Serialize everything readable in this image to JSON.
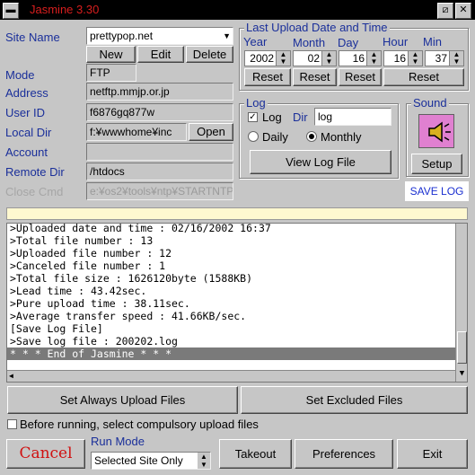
{
  "window": {
    "title": "Jasmine 3.30"
  },
  "site": {
    "site_name_label": "Site Name",
    "site_name_value": "prettypop.net",
    "new_label": "New",
    "edit_label": "Edit",
    "delete_label": "Delete",
    "mode_label": "Mode",
    "mode_value": "FTP",
    "address_label": "Address",
    "address_value": "netftp.mmjp.or.jp",
    "userid_label": "User ID",
    "userid_value": "f6876gq877w",
    "localdir_label": "Local Dir",
    "localdir_value": "f:¥wwwhome¥inc",
    "open_label": "Open",
    "account_label": "Account",
    "account_value": "",
    "remotedir_label": "Remote Dir",
    "remotedir_value": "/htdocs",
    "closecmd_label": "Close Cmd",
    "closecmd_value": "e:¥os2¥tools¥ntp¥STARTNTP"
  },
  "upload": {
    "group_label": "Last Upload Date and Time",
    "year_label": "Year",
    "month_label": "Month",
    "day_label": "Day",
    "hour_label": "Hour",
    "min_label": "Min",
    "year": "2002",
    "month": "02",
    "day": "16",
    "hour": "16",
    "min": "37",
    "reset_label": "Reset"
  },
  "log_group": {
    "group_label": "Log",
    "log_check_label": "Log",
    "dir_label": "Dir",
    "dir_value": "log",
    "daily_label": "Daily",
    "monthly_label": "Monthly",
    "view_label": "View Log File"
  },
  "sound": {
    "group_label": "Sound",
    "setup_label": "Setup",
    "save_log_label": "SAVE LOG"
  },
  "log_lines": [
    ">Uploaded date and time : 02/16/2002 16:37",
    ">Total file number : 13",
    ">Uploaded file number : 12",
    ">Canceled file number : 1",
    ">Total file size : 1626120byte (1588KB)",
    ">Lead time : 43.42sec.",
    ">Pure upload time : 38.11sec.",
    ">Average transfer speed : 41.66KB/sec.",
    "[Save Log File]",
    ">Save log file : 200202.log",
    "* * * End of Jasmine * * *"
  ],
  "bottom": {
    "always_upload_label": "Set Always Upload Files",
    "excluded_label": "Set Excluded Files",
    "before_running_label": "Before running, select compulsory upload files",
    "cancel_label": "Cancel",
    "run_mode_label": "Run Mode",
    "run_mode_value": "Selected Site Only",
    "takeout_label": "Takeout",
    "preferences_label": "Preferences",
    "exit_label": "Exit"
  },
  "colors": {
    "label_blue": "#1a2f9a",
    "title_red": "#d81e1e",
    "cancel_red": "#d01010"
  }
}
